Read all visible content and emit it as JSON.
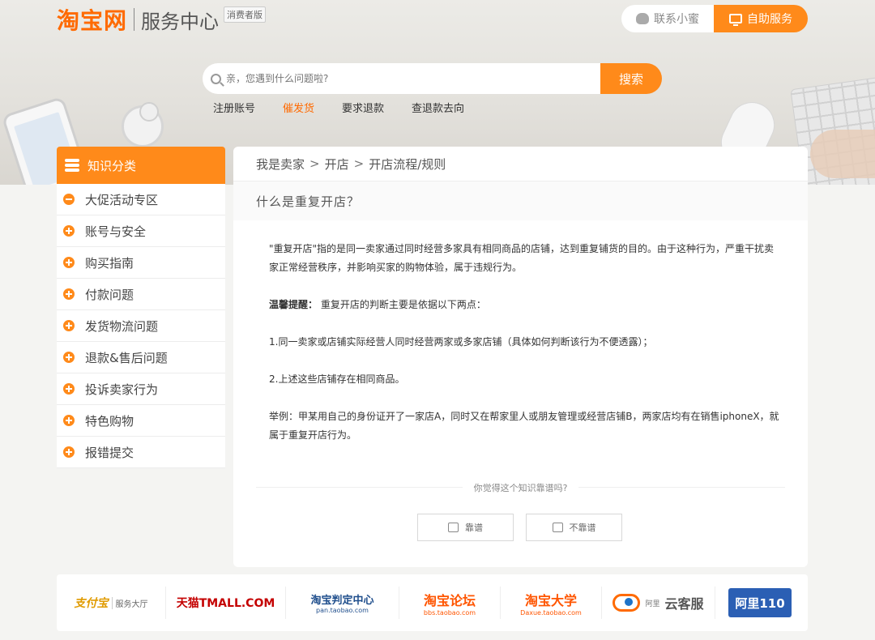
{
  "header": {
    "logo_main": "淘宝网",
    "logo_sub": "服务中心",
    "logo_badge": "消费者版",
    "contact_label": "联系小蜜",
    "self_service_label": "自助服务"
  },
  "search": {
    "placeholder": "亲，您遇到什么问题啦?",
    "button_label": "搜索"
  },
  "quick_links": [
    {
      "label": "注册账号",
      "active": false
    },
    {
      "label": "催发货",
      "active": true
    },
    {
      "label": "要求退款",
      "active": false
    },
    {
      "label": "查退款去向",
      "active": false
    }
  ],
  "sidebar": {
    "title": "知识分类",
    "items": [
      {
        "label": "大促活动专区",
        "icon": "minus-circle-icon"
      },
      {
        "label": "账号与安全",
        "icon": "plus-circle-icon"
      },
      {
        "label": "购买指南",
        "icon": "plus-circle-icon"
      },
      {
        "label": "付款问题",
        "icon": "plus-circle-icon"
      },
      {
        "label": "发货物流问题",
        "icon": "plus-circle-icon"
      },
      {
        "label": "退款&售后问题",
        "icon": "plus-circle-icon"
      },
      {
        "label": "投诉卖家行为",
        "icon": "plus-circle-icon"
      },
      {
        "label": "特色购物",
        "icon": "plus-circle-icon"
      },
      {
        "label": "报错提交",
        "icon": "plus-circle-icon"
      }
    ]
  },
  "breadcrumb": [
    "我是卖家",
    "开店",
    "开店流程/规则"
  ],
  "breadcrumb_sep": ">",
  "question": "什么是重复开店？",
  "article": {
    "p1": "\"重复开店\"指的是同一卖家通过同时经营多家具有相同商品的店铺，达到重复铺货的目的。由于这种行为，严重干扰卖家正常经营秩序，并影响买家的购物体验，属于违规行为。",
    "tip_label": "温馨提醒：",
    "tip_text": " 重复开店的判断主要是依据以下两点：",
    "p3": "1.同一卖家或店铺实际经营人同时经营两家或多家店铺（具体如何判断该行为不便透露）；",
    "p4": "2.上述这些店铺存在相同商品。",
    "p5": "举例：甲某用自己的身份证开了一家店A，同时又在帮家里人或朋友管理或经营店铺B，两家店均有在销售iphoneX，就属于重复开店行为。"
  },
  "feedback": {
    "question": "你觉得这个知识靠谱吗?",
    "yes_label": "靠谱",
    "no_label": "不靠谱"
  },
  "footer": {
    "alipay_main": "支付宝",
    "alipay_sub": "服务大厅",
    "tmall": "天猫TMALL.COM",
    "judge_main": "淘宝判定中心",
    "judge_sub": "pan.taobao.com",
    "bbs_main": "淘宝论坛",
    "bbs_sub": "bbs.taobao.com",
    "dx_main": "淘宝大学",
    "dx_sub": "Daxue.taobao.com",
    "yun_pre": "阿里",
    "yun_main": "云客服",
    "ali110": "阿里110"
  },
  "colors": {
    "accent": "#ff8a1a",
    "brand": "#ff6a00"
  }
}
